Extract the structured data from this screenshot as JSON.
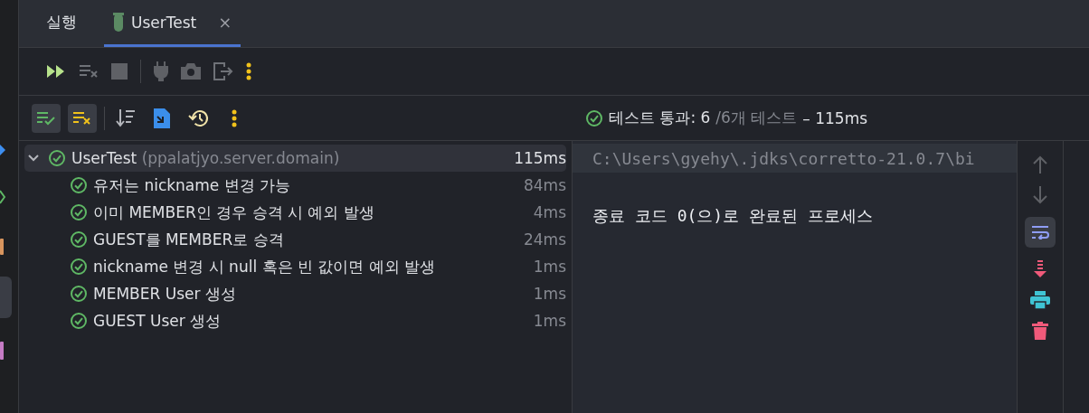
{
  "tabs": [
    {
      "kind": "plain",
      "label": "실행",
      "selected": false
    },
    {
      "kind": "test",
      "label": "UserTest",
      "selected": true,
      "close": "×"
    }
  ],
  "filters": [
    {
      "kind": "passed",
      "selected": true
    },
    {
      "kind": "ignored",
      "selected": true
    }
  ],
  "status": {
    "ok": true,
    "passed": "테스트 통과: 6",
    "total": "/6개 테스트",
    "duration": "– 115ms"
  },
  "tree": {
    "name": "UserTest",
    "package": "(ppalatjyo.server.domain)",
    "duration": "115ms",
    "ok": true,
    "expanded": true,
    "selected": true,
    "children": [
      {
        "name": "유저는 nickname 변경 가능",
        "duration": "84ms",
        "ok": true
      },
      {
        "name": "이미 MEMBER인 경우 승격 시 예외 발생",
        "duration": "4ms",
        "ok": true
      },
      {
        "name": "GUEST를 MEMBER로 승격",
        "duration": "24ms",
        "ok": true
      },
      {
        "name": "nickname 변경 시 null 혹은 빈 값이면 예외 발생",
        "duration": "1ms",
        "ok": true
      },
      {
        "name": "MEMBER User 생성",
        "duration": "1ms",
        "ok": true
      },
      {
        "name": "GUEST User 생성",
        "duration": "1ms",
        "ok": true
      }
    ]
  },
  "console": {
    "lines": [
      {
        "kind": "command",
        "text": "C:\\Users\\gyehy\\.jdks\\corretto-21.0.7\\bi"
      },
      {
        "kind": "blank"
      },
      {
        "kind": "output",
        "text": "종료 코드 0(으)로 완료된 프로세스"
      }
    ]
  },
  "soft_wrap": {
    "selected": true
  }
}
